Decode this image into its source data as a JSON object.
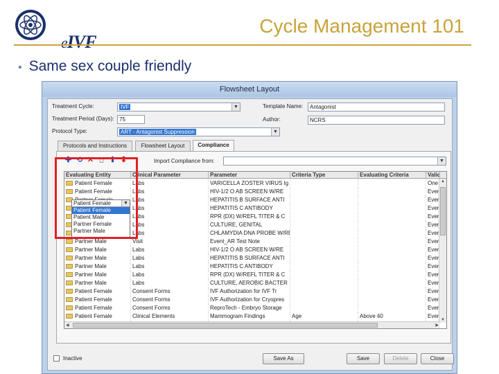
{
  "slide": {
    "logo_text_prefix": "e",
    "logo_text": "IVF",
    "title": "Cycle Management 101",
    "bullet": "Same sex couple friendly"
  },
  "window": {
    "title": "Flowsheet Layout",
    "treatment_cycle_label": "Treatment Cycle:",
    "treatment_cycle_value": "IVF",
    "treatment_period_label": "Treatment Period (Days):",
    "treatment_period_value": "75",
    "protocol_type_label": "Protocol Type:",
    "protocol_type_value": "ART - Antagonist Suppression",
    "template_name_label": "Template Name:",
    "template_name_value": "Antagonist",
    "author_label": "Author:",
    "author_value": "NCRS",
    "tabs": [
      "Protocols and Instructions",
      "Flowsheet Layout",
      "Compliance"
    ],
    "active_tab": 2,
    "import_label": "Import Compliance from:",
    "import_value": "",
    "toolbar_icons": [
      "plus-icon",
      "refresh-icon",
      "delete-icon",
      "blank-icon",
      "arrow-up-icon",
      "arrow-down-icon"
    ],
    "columns": [
      "Evaluating Entity",
      "Clinical Parameter",
      "Parameter",
      "Criteria Type",
      "Evaluating Criteria",
      "Validity"
    ],
    "rows": [
      [
        "Patient Female",
        "Labs",
        "VARICELLA ZOSTER VIRUS Ig",
        "",
        "",
        "One Ti"
      ],
      [
        "Patient Female",
        "Labs",
        "HIV-1/2 O AB SCREEN W/RE",
        "",
        "",
        "Every"
      ],
      [
        "Partner Female",
        "Labs",
        "HEPATITIS B SURFACE ANTI",
        "",
        "",
        "Every"
      ],
      [
        "Partner Female",
        "Labs",
        "HEPATITIS C ANTIBODY",
        "",
        "",
        "Every"
      ],
      [
        "Partner Female",
        "Labs",
        "RPR (DX) W/REFL TITER & C",
        "",
        "",
        "Every"
      ],
      [
        "Patient Female",
        "Labs",
        "CULTURE, GENITAL",
        "",
        "",
        "Every"
      ],
      [
        "Patient Female",
        "Labs",
        "CHLAMYDIA DNA PROBE W/RE",
        "",
        "",
        "Every"
      ],
      [
        "Partner Male",
        "Visit",
        "Event_AR Test Note",
        "",
        "",
        "Every"
      ],
      [
        "Partner Male",
        "Labs",
        "HIV-1/2 O AB SCREEN W/RE",
        "",
        "",
        "Every"
      ],
      [
        "Partner Male",
        "Labs",
        "HEPATITIS B SURFACE ANTI",
        "",
        "",
        "Every"
      ],
      [
        "Partner Male",
        "Labs",
        "HEPATITIS C ANTIBODY",
        "",
        "",
        "Every"
      ],
      [
        "Partner Male",
        "Labs",
        "RPR (DX) W/REFL TITER & C",
        "",
        "",
        "Every"
      ],
      [
        "Partner Male",
        "Labs",
        "CULTURE, AEROBIC BACTER",
        "",
        "",
        "Every"
      ],
      [
        "Patient Female",
        "Consent Forms",
        "IVF Authorization for IVF Tr",
        "",
        "",
        "Every"
      ],
      [
        "Patient Female",
        "Consent Forms",
        "IVF Authorization for Cryopres",
        "",
        "",
        "Every"
      ],
      [
        "Patient Female",
        "Consent Forms",
        "ReproTech - Embryo Storage",
        "",
        "",
        "Every"
      ],
      [
        "Patient Female",
        "Clinical Elements",
        "Mammogram Findings",
        "Age",
        "Above 40",
        "Every"
      ],
      [
        "",
        "",
        "",
        "",
        "",
        ""
      ]
    ],
    "entity_dropdown": {
      "current": "Patient Female",
      "options": [
        "Patient Female",
        "Patient Male",
        "Partner Female",
        "Partner Male"
      ],
      "highlighted": 0
    },
    "inactive_label": "Inactive",
    "buttons": {
      "save_as": "Save As",
      "save": "Save",
      "delete": "Delete",
      "close": "Close"
    },
    "highlight_color": "#e21f26"
  }
}
